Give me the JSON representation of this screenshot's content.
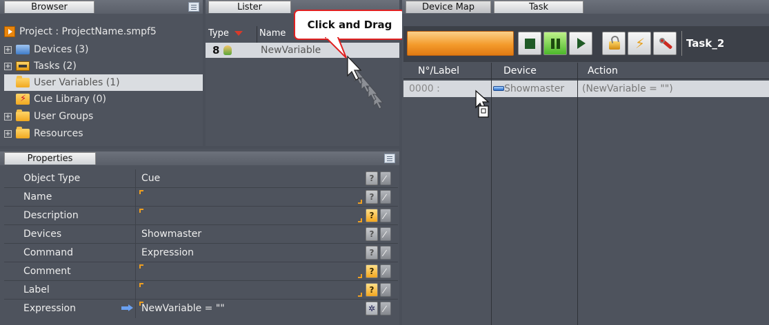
{
  "browser": {
    "tab_label": "Browser",
    "items": [
      {
        "label": "Project : ProjectName.smpf5",
        "icon": "project-icon"
      },
      {
        "label": "Devices (3)",
        "icon": "devices-icon",
        "expander": "+"
      },
      {
        "label": "Tasks (2)",
        "icon": "tasks-icon",
        "expander": "+"
      },
      {
        "label": "User Variables (1)",
        "icon": "user-variables-icon"
      },
      {
        "label": "Cue Library (0)",
        "icon": "cue-library-icon"
      },
      {
        "label": "User Groups",
        "icon": "folder-icon",
        "expander": "+"
      },
      {
        "label": "Resources",
        "icon": "folder-icon",
        "expander": "+"
      }
    ]
  },
  "lister": {
    "tab_label": "Lister",
    "columns": [
      "Type",
      "Name"
    ],
    "rows": [
      {
        "type_glyph": "8",
        "name": "NewVariable"
      }
    ]
  },
  "callout": {
    "text": "Click and Drag"
  },
  "properties": {
    "tab_label": "Properties",
    "rows": [
      {
        "label": "Object Type",
        "value": "Cue"
      },
      {
        "label": "Name",
        "value": ""
      },
      {
        "label": "Description",
        "value": ""
      },
      {
        "label": "Devices",
        "value": "Showmaster"
      },
      {
        "label": "Command",
        "value": "Expression"
      },
      {
        "label": "Comment",
        "value": ""
      },
      {
        "label": "Label",
        "value": ""
      },
      {
        "label": "Expression",
        "value": "NewVariable = \"\""
      }
    ]
  },
  "task_panel": {
    "tabs": [
      "Device Map",
      "Task"
    ],
    "task_name": "Task_2",
    "columns": [
      "N°/Label",
      "Device",
      "Action"
    ],
    "rows": [
      {
        "label": "0000 :",
        "device": "Showmaster",
        "action": "(NewVariable = \"\")"
      }
    ]
  },
  "colors": {
    "accent": "#f0a020",
    "background": "#4e535d",
    "callout_border": "#e02020"
  }
}
